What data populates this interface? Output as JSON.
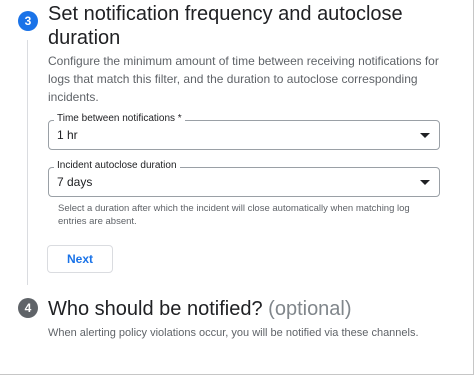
{
  "step3": {
    "number": "3",
    "title": "Set notification frequency and autoclose duration",
    "description": "Configure the minimum amount of time between receiving notifications for logs that match this filter, and the duration to autoclose corresponding incidents.",
    "fields": [
      {
        "label": "Time between notifications *",
        "value": "1 hr"
      },
      {
        "label": "Incident autoclose duration",
        "value": "7 days",
        "hint": "Select a duration after which the incident will close automatically when matching log entries are absent."
      }
    ],
    "next_label": "Next"
  },
  "step4": {
    "number": "4",
    "title": "Who should be notified?",
    "optional": "(optional)",
    "description": "When alerting policy violations occur, you will be notified via these channels."
  },
  "colors": {
    "accent": "#1a73e8",
    "inactive_step": "#5f6368"
  }
}
